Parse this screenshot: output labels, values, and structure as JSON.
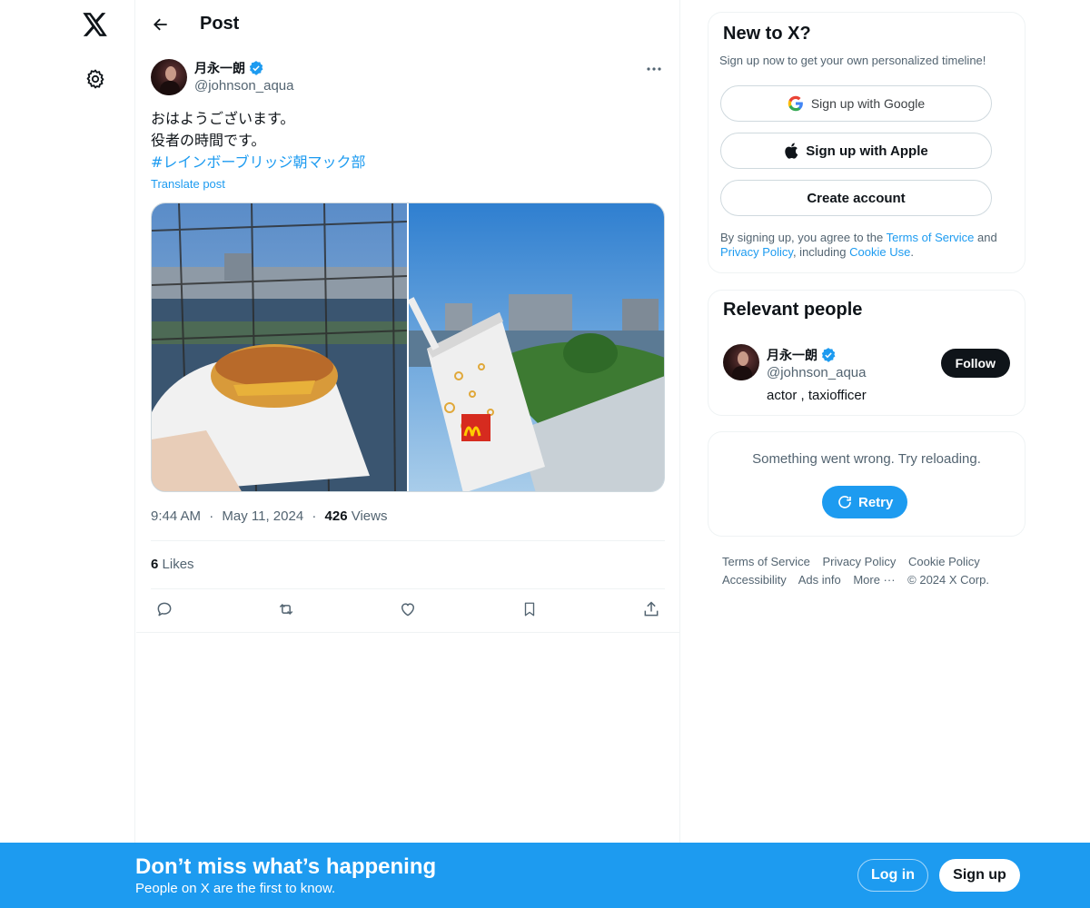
{
  "nav": {
    "logo_icon": "x-logo-icon",
    "settings_icon": "gear-icon"
  },
  "header": {
    "title": "Post"
  },
  "post": {
    "author": {
      "display_name": "月永一朗",
      "handle": "@johnson_aqua",
      "verified": true
    },
    "text_lines": [
      "おはようございます。",
      "役者の時間です。"
    ],
    "hashtag": "#レインボーブリッジ朝マック部",
    "translate_label": "Translate post",
    "time": "9:44 AM",
    "date": "May 11, 2024",
    "views_count": "426",
    "views_label": "Views",
    "likes_count": "6",
    "likes_label": "Likes",
    "separator": "·"
  },
  "signup_card": {
    "title": "New to X?",
    "subtitle": "Sign up now to get your own personalized timeline!",
    "google_label": "Sign up with Google",
    "apple_label": "Sign up with Apple",
    "create_label": "Create account",
    "legal_prefix": "By signing up, you agree to the ",
    "terms_link": "Terms of Service",
    "legal_and": " and ",
    "privacy_link": "Privacy Policy",
    "legal_including": ", including ",
    "cookie_link": "Cookie Use",
    "legal_end": "."
  },
  "relevant": {
    "title": "Relevant people",
    "display_name": "月永一朗",
    "handle": "@johnson_aqua",
    "bio": "actor , taxiofficer",
    "follow_label": "Follow"
  },
  "error_card": {
    "message": "Something went wrong. Try reloading.",
    "retry_label": "Retry"
  },
  "footer": {
    "links": [
      "Terms of Service",
      "Privacy Policy",
      "Cookie Policy",
      "Accessibility",
      "Ads info",
      "More ···",
      "© 2024 X Corp."
    ]
  },
  "banner": {
    "title": "Don’t miss what’s happening",
    "subtitle": "People on X are the first to know.",
    "login_label": "Log in",
    "signup_label": "Sign up"
  },
  "colors": {
    "accent": "#1d9bf0",
    "text": "#0f1419",
    "muted": "#536471",
    "border": "#eff3f4"
  }
}
